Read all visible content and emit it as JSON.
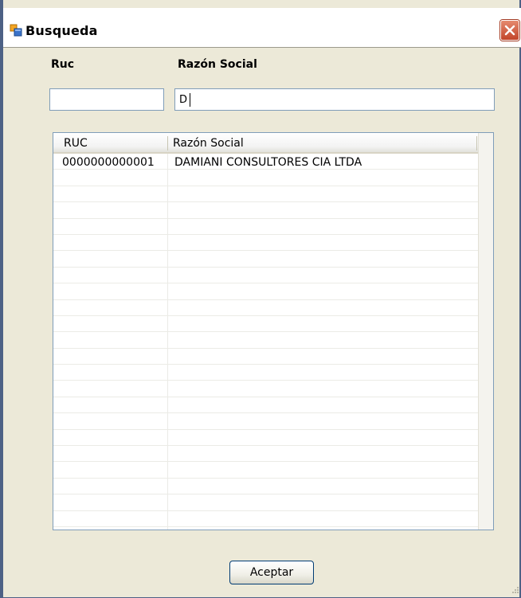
{
  "window": {
    "title": "Busqueda"
  },
  "filters": {
    "ruc_label": "Ruc",
    "ruc_value": "",
    "razon_label": "Razón Social",
    "razon_value": "D"
  },
  "grid": {
    "columns": [
      "RUC",
      "Razón Social"
    ],
    "rows": [
      {
        "ruc": "0000000000001",
        "razon": "DAMIANI CONSULTORES CIA LTDA"
      }
    ]
  },
  "buttons": {
    "accept_label": "Aceptar"
  },
  "colors": {
    "window_bg": "#ECE9D8",
    "border_blue": "#7f9db9",
    "close_red": "#c2452a"
  },
  "icons": {
    "app": "window-app-icon",
    "close": "close-icon"
  }
}
